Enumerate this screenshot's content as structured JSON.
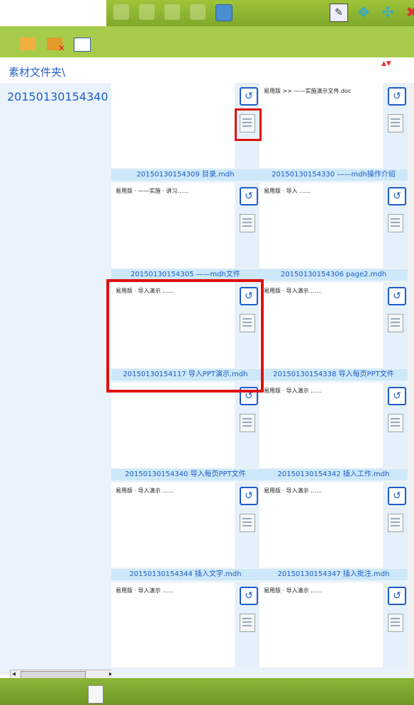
{
  "path_label": "素材文件夹\\",
  "folder_name": "20150130154340",
  "sort_icon_name": "sort-icon",
  "cells": [
    {
      "caption": "",
      "doc_title": "",
      "doc_sub": ""
    },
    {
      "caption": "",
      "doc_title": "易用版 >> ——实施演示文件.doc",
      "doc_sub": ""
    },
    {
      "caption": "20150130154309 目录.mdh",
      "doc_title": "易用版 · ——实施 · 讲习……",
      "doc_sub": ""
    },
    {
      "caption": "20150130154330 ——mdh操作介绍",
      "doc_title": "易用版 · 导入 ……",
      "doc_sub": ""
    },
    {
      "caption": "20150130154305 ——mdh文件",
      "doc_title": "易用版 · 导入演示 ……",
      "doc_sub": ""
    },
    {
      "caption": "20150130154306 page2.mdh",
      "doc_title": "易用版 · 导入演示 ……",
      "doc_sub": ""
    },
    {
      "caption": "20150130154117 导入PPT演示.mdh",
      "doc_title": "",
      "doc_sub": ""
    },
    {
      "caption": "20150130154338 导入每页PPT文件",
      "doc_title": "易用版 · 导入演示 ……",
      "doc_sub": ""
    },
    {
      "caption": "20150130154340 导入每页PPT文件",
      "doc_title": "易用版 · 导入演示 ……",
      "doc_sub": ""
    },
    {
      "caption": "20150130154342 插入工作.mdh",
      "doc_title": "易用版 · 导入演示 ……",
      "doc_sub": ""
    },
    {
      "caption": "20150130154344 插入文字.mdh",
      "doc_title": "易用版 · 导入演示 ……",
      "doc_sub": ""
    },
    {
      "caption": "20150130154347 插入批注.mdh",
      "doc_title": "易用版 · 导入演示 ……",
      "doc_sub": ""
    }
  ]
}
